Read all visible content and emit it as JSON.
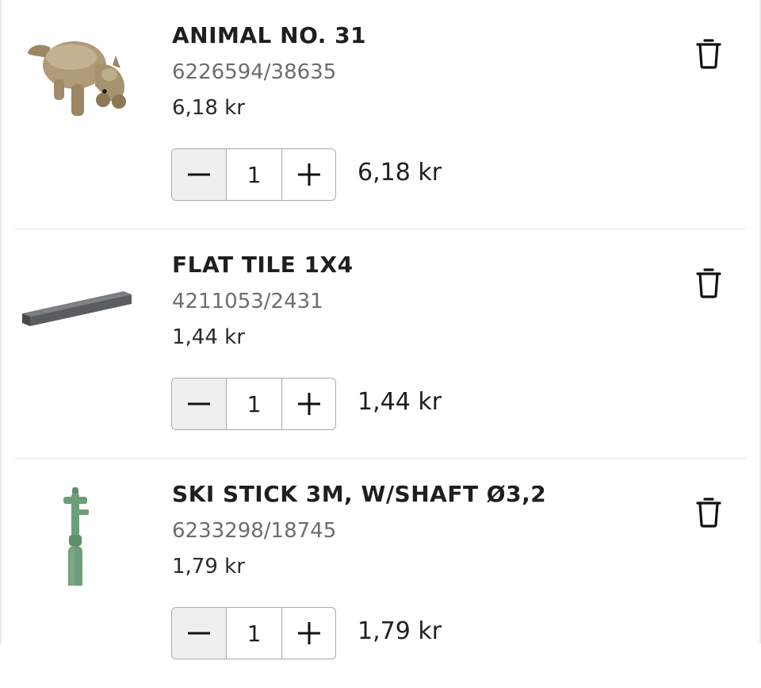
{
  "cart": {
    "items": [
      {
        "title": "ANIMAL NO. 31",
        "sku": "6226594/38635",
        "unit_price": "6,18 kr",
        "quantity": "1",
        "line_total": "6,18 kr",
        "image_icon": "rat-figure-image",
        "color": "#b09b78"
      },
      {
        "title": "FLAT TILE 1X4",
        "sku": "4211053/2431",
        "unit_price": "1,44 kr",
        "quantity": "1",
        "line_total": "1,44 kr",
        "image_icon": "flat-tile-image",
        "color": "#5f6366"
      },
      {
        "title": "SKI STICK 3M, W/SHAFT Ø3,2",
        "sku": "6233298/18745",
        "unit_price": "1,79 kr",
        "quantity": "1",
        "line_total": "1,79 kr",
        "image_icon": "ski-stick-image",
        "color": "#6e9e78"
      }
    ],
    "icons": {
      "delete": "trash-icon",
      "decrement": "minus-icon",
      "increment": "plus-icon"
    }
  }
}
